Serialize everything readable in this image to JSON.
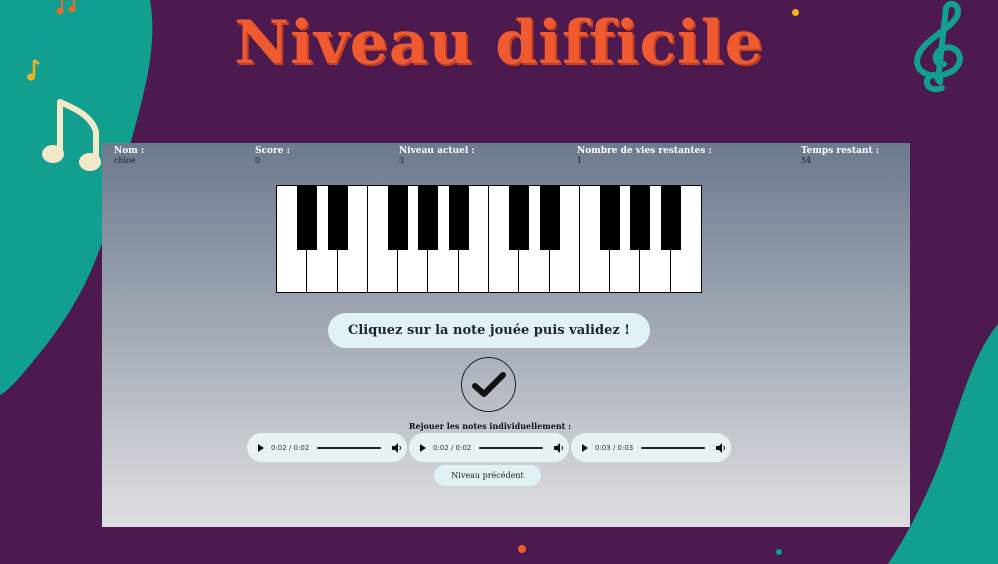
{
  "page": {
    "title": "Niveau difficile"
  },
  "info": {
    "name_label": "Nom :",
    "name_value": "chloe",
    "score_label": "Score :",
    "score_value": "0",
    "level_label": "Niveau actuel :",
    "level_value": "3",
    "lives_label": "Nombre de vies restantes :",
    "lives_value": "1",
    "time_label": "Temps restant :",
    "time_value": "54"
  },
  "piano": {
    "white_keys": 14,
    "black_key_icons": "piano-key"
  },
  "instruction": "Cliquez sur la note jouée puis validez !",
  "validate_icon": "checkmark-icon",
  "replay_label": "Rejouer les notes individuellement :",
  "audio_players": [
    {
      "time": "0:02 / 0:02"
    },
    {
      "time": "0:02 / 0:02"
    },
    {
      "time": "0:03 / 0:03"
    }
  ],
  "prev_button": "Niveau précédent",
  "colors": {
    "background": "#4d1a50",
    "teal": "#10a08e",
    "title": "#f05a30",
    "note": "#f3e9c8"
  }
}
